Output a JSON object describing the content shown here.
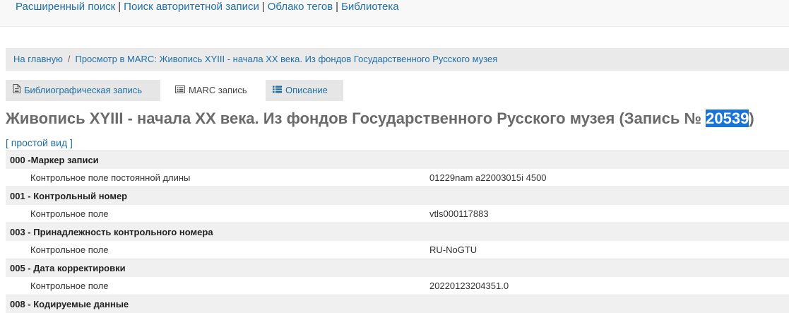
{
  "topnav": {
    "items": [
      "Расширенный поиск",
      "Поиск авторитетной записи",
      "Облако тегов",
      "Библиотека"
    ],
    "separator": "|"
  },
  "breadcrumb": {
    "home": "На главную",
    "separator": "/",
    "current": "Просмотр в MARC: Живопись XYIII - начала XX века. Из фондов Государственного Русского музея"
  },
  "tabs": [
    {
      "label": "Библиографическая запись",
      "icon": "document-icon",
      "active": false
    },
    {
      "label": "MARC запись",
      "icon": "list-box-icon",
      "active": true
    },
    {
      "label": "Описание",
      "icon": "list-icon",
      "active": false
    }
  ],
  "title": {
    "text": "Живопись XYIII - начала XX века. Из фондов Государственного Русского музея (Запись № ",
    "record_number": "20539",
    "suffix": ")"
  },
  "simple_view": {
    "open": "[ ",
    "label": "простой вид",
    "close": " ]"
  },
  "marc_fields": [
    {
      "tag_label": "000 -Маркер записи",
      "sub_label": "Контрольное поле постоянной длины",
      "value": "01229nam a22003015i 4500"
    },
    {
      "tag_label": "001 - Контрольный номер",
      "sub_label": "Контрольное поле",
      "value": "vtls000117883"
    },
    {
      "tag_label": "003 - Принадлежность контрольного номера",
      "sub_label": "Контрольное поле",
      "value": "RU-NoGTU"
    },
    {
      "tag_label": "005 - Дата корректировки",
      "sub_label": "Контрольное поле",
      "value": "20220123204351.0"
    },
    {
      "tag_label": "008 - Кодируемые данные",
      "sub_label": "",
      "value": ""
    }
  ],
  "colors": {
    "link": "#1f6fa5",
    "highlight": "#1a73d9",
    "header_row_bg": "#f0f0f0",
    "breadcrumb_bg": "#eaeaea"
  }
}
